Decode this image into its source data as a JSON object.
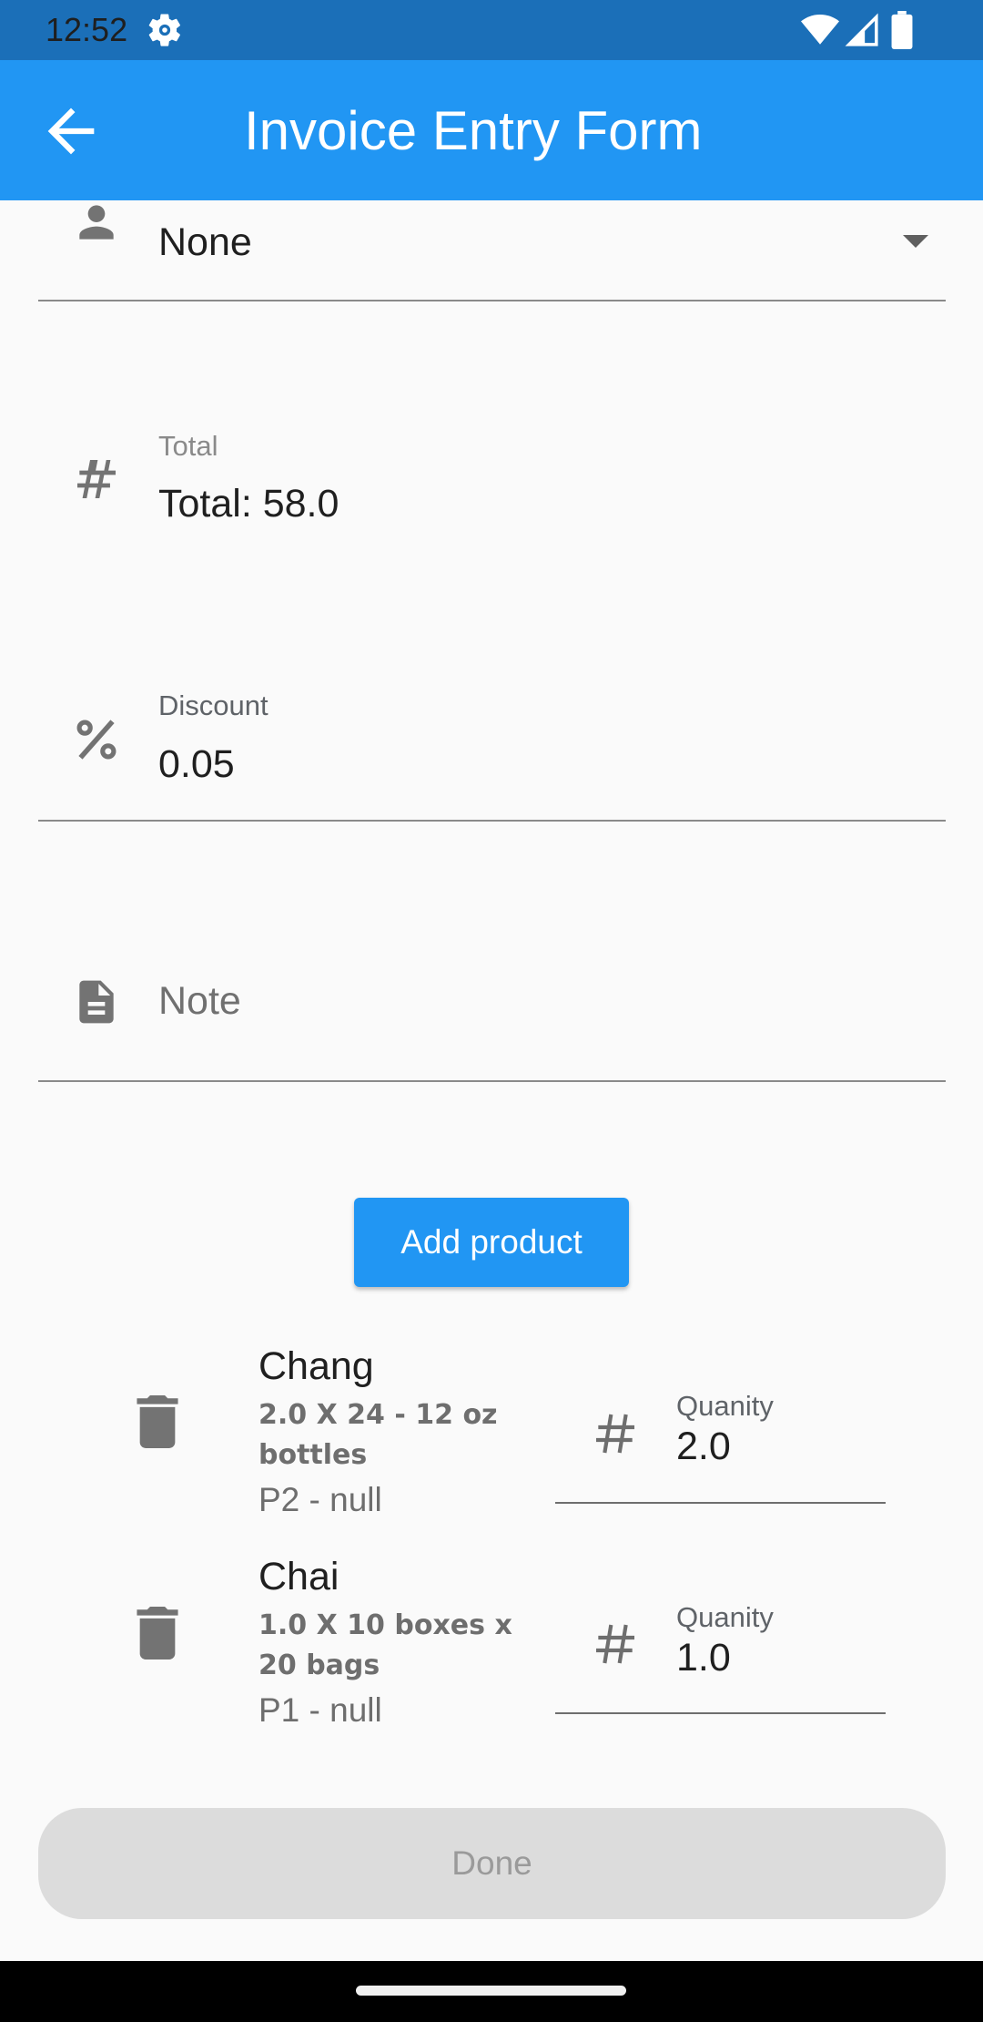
{
  "status_bar": {
    "time": "12:52",
    "icons": [
      "settings-gear-icon",
      "wifi-icon",
      "cell-signal-icon",
      "battery-icon"
    ]
  },
  "app_bar": {
    "title": "Invoice Entry Form",
    "back_icon": "arrow-back-icon",
    "color": "#2196f3"
  },
  "form": {
    "customer": {
      "icon": "person-icon",
      "value": "None"
    },
    "total": {
      "icon": "hash-icon",
      "label": "Total",
      "value": "Total: 58.0"
    },
    "discount": {
      "icon": "percent-icon",
      "label": "Discount",
      "value": "0.05"
    },
    "note": {
      "icon": "document-icon",
      "placeholder": "Note"
    },
    "add_product_label": "Add product"
  },
  "products": [
    {
      "name": "Chang",
      "description": "2.0 X 24 - 12 oz bottles",
      "code": "P2 - null",
      "quantity_label": "Quanity",
      "quantity": "2.0"
    },
    {
      "name": "Chai",
      "description": "1.0 X 10 boxes x 20 bags",
      "code": "P1 - null",
      "quantity_label": "Quanity",
      "quantity": "1.0"
    }
  ],
  "done_label": "Done"
}
